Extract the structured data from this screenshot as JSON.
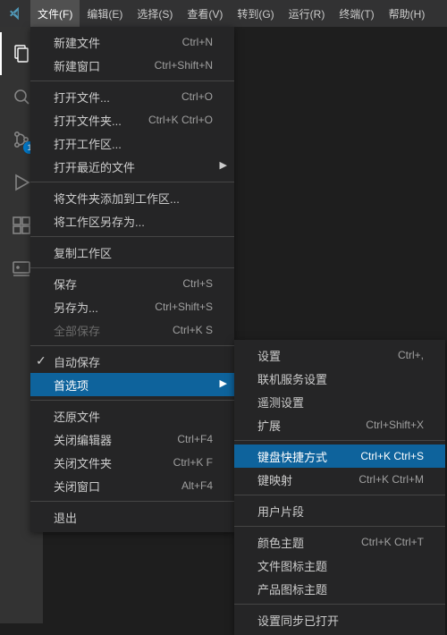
{
  "menubar": {
    "items": [
      {
        "label": "文件(F)",
        "active": true
      },
      {
        "label": "编辑(E)"
      },
      {
        "label": "选择(S)"
      },
      {
        "label": "查看(V)"
      },
      {
        "label": "转到(G)"
      },
      {
        "label": "运行(R)"
      },
      {
        "label": "终端(T)"
      },
      {
        "label": "帮助(H)"
      }
    ]
  },
  "activitybar": {
    "items": [
      {
        "name": "explorer",
        "active": true
      },
      {
        "name": "search"
      },
      {
        "name": "source-control",
        "badge": "1"
      },
      {
        "name": "run-debug"
      },
      {
        "name": "extensions"
      },
      {
        "name": "remote"
      }
    ]
  },
  "fileMenu": [
    {
      "type": "item",
      "label": "新建文件",
      "short": "Ctrl+N"
    },
    {
      "type": "item",
      "label": "新建窗口",
      "short": "Ctrl+Shift+N"
    },
    {
      "type": "sep"
    },
    {
      "type": "item",
      "label": "打开文件...",
      "short": "Ctrl+O"
    },
    {
      "type": "item",
      "label": "打开文件夹...",
      "short": "Ctrl+K Ctrl+O"
    },
    {
      "type": "item",
      "label": "打开工作区..."
    },
    {
      "type": "item",
      "label": "打开最近的文件",
      "submenu": true
    },
    {
      "type": "sep"
    },
    {
      "type": "item",
      "label": "将文件夹添加到工作区..."
    },
    {
      "type": "item",
      "label": "将工作区另存为..."
    },
    {
      "type": "sep"
    },
    {
      "type": "item",
      "label": "复制工作区"
    },
    {
      "type": "sep"
    },
    {
      "type": "item",
      "label": "保存",
      "short": "Ctrl+S"
    },
    {
      "type": "item",
      "label": "另存为...",
      "short": "Ctrl+Shift+S"
    },
    {
      "type": "item",
      "label": "全部保存",
      "short": "Ctrl+K S",
      "disabled": true
    },
    {
      "type": "sep"
    },
    {
      "type": "item",
      "label": "自动保存",
      "checked": true
    },
    {
      "type": "item",
      "label": "首选项",
      "submenu": true,
      "highlighted": true
    },
    {
      "type": "sep"
    },
    {
      "type": "item",
      "label": "还原文件"
    },
    {
      "type": "item",
      "label": "关闭编辑器",
      "short": "Ctrl+F4"
    },
    {
      "type": "item",
      "label": "关闭文件夹",
      "short": "Ctrl+K F"
    },
    {
      "type": "item",
      "label": "关闭窗口",
      "short": "Alt+F4"
    },
    {
      "type": "sep"
    },
    {
      "type": "item",
      "label": "退出"
    }
  ],
  "prefMenu": [
    {
      "type": "item",
      "label": "设置",
      "short": "Ctrl+,"
    },
    {
      "type": "item",
      "label": "联机服务设置"
    },
    {
      "type": "item",
      "label": "遥测设置"
    },
    {
      "type": "item",
      "label": "扩展",
      "short": "Ctrl+Shift+X"
    },
    {
      "type": "sep"
    },
    {
      "type": "item",
      "label": "键盘快捷方式",
      "short": "Ctrl+K Ctrl+S",
      "highlighted": true
    },
    {
      "type": "item",
      "label": "键映射",
      "short": "Ctrl+K Ctrl+M"
    },
    {
      "type": "sep"
    },
    {
      "type": "item",
      "label": "用户片段"
    },
    {
      "type": "sep"
    },
    {
      "type": "item",
      "label": "颜色主题",
      "short": "Ctrl+K Ctrl+T"
    },
    {
      "type": "item",
      "label": "文件图标主题"
    },
    {
      "type": "item",
      "label": "产品图标主题"
    },
    {
      "type": "sep"
    },
    {
      "type": "item",
      "label": "设置同步已打开"
    }
  ]
}
